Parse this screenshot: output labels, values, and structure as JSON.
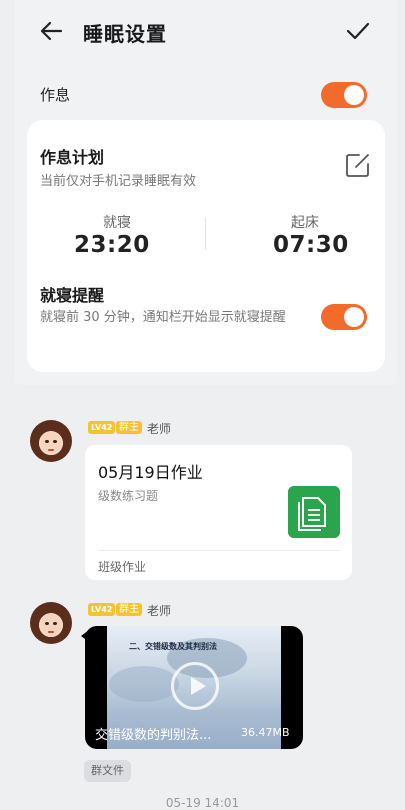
{
  "settings": {
    "title": "睡眠设置",
    "rest_label": "作息",
    "rest_toggle_on": true,
    "plan": {
      "title": "作息计划",
      "subtitle": "当前仅对手机记录睡眠有效",
      "sleep_label": "就寝",
      "sleep_time": "23:20",
      "wake_label": "起床",
      "wake_time": "07:30"
    },
    "reminder": {
      "title": "就寝提醒",
      "subtitle": "就寝前 30 分钟，通知栏开始显示就寝提醒",
      "toggle_on": true
    },
    "accent": "#f26b2a"
  },
  "chat": {
    "messages": [
      {
        "level_badge": "LV42",
        "role_badge": "群主",
        "sender": "老师",
        "card": {
          "title": "05月19日作业",
          "subtitle": "级数练习题",
          "footer": "班级作业"
        }
      },
      {
        "level_badge": "LV42",
        "role_badge": "群主",
        "sender": "老师",
        "video": {
          "frame_text": "二、交错级数及其判别法",
          "name": "交错级数的判别法...",
          "size": "36.47MB"
        },
        "tag": "群文件"
      }
    ],
    "timestamp": "05-19 14:01"
  },
  "icons": {
    "back": "back-arrow-icon",
    "confirm": "check-icon",
    "edit": "edit-icon",
    "doc": "document-icon",
    "play": "play-icon"
  }
}
